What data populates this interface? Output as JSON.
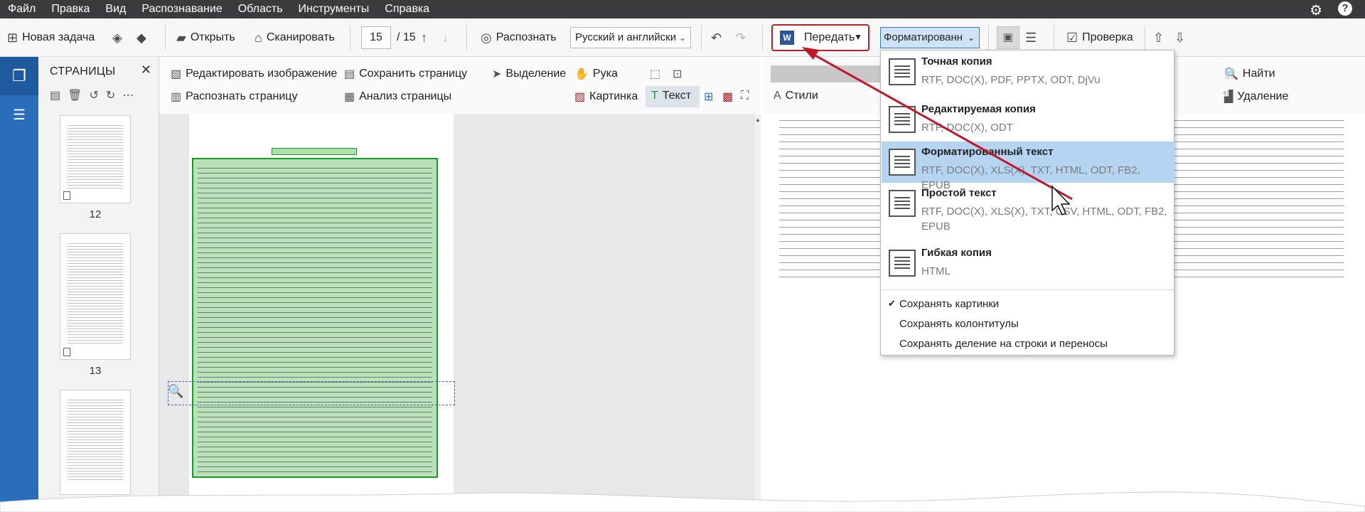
{
  "menubar": {
    "items": [
      "Файл",
      "Правка",
      "Вид",
      "Распознавание",
      "Область",
      "Инструменты",
      "Справка"
    ],
    "help_label": "?"
  },
  "toolbar": {
    "new_task": "Новая задача",
    "open": "Открыть",
    "scan": "Сканировать",
    "page_current": "15",
    "page_total": "/ 15",
    "recognize": "Распознать",
    "language": "Русский и английски",
    "transfer": "Передать",
    "transfer_icon_letter": "W",
    "format": "Форматированн",
    "check": "Проверка"
  },
  "pages_panel": {
    "title": "СТРАНИЦЫ",
    "page_numbers": [
      "12",
      "13"
    ]
  },
  "image_tools": {
    "edit_image": "Редактировать изображение",
    "save_page": "Сохранить страницу",
    "recognize_page": "Распознать страницу",
    "analyze_page": "Анализ страницы",
    "selection": "Выделение",
    "hand": "Рука",
    "text": "Текст",
    "picture": "Картинка"
  },
  "text_tools": {
    "styles": "Стили",
    "find": "Найти",
    "delete": "Удаление"
  },
  "format_menu": {
    "options": [
      {
        "title": "Точная копия",
        "desc": "RTF, DOC(X), PDF, PPTX, ODT, DjVu",
        "selected": false
      },
      {
        "title": "Редактируемая копия",
        "desc": "RTF, DOC(X), ODT",
        "selected": false
      },
      {
        "title": "Форматированный текст",
        "desc": "RTF, DOC(X), XLS(X), TXT, HTML, ODT, FB2, EPUB",
        "selected": true
      },
      {
        "title": "Простой текст",
        "desc": "RTF, DOC(X), XLS(X), TXT, CSV, HTML, ODT, FB2, EPUB",
        "selected": false
      },
      {
        "title": "Гибкая копия",
        "desc": "HTML",
        "selected": false
      }
    ],
    "checks": [
      {
        "label": "Сохранять картинки",
        "checked": true
      },
      {
        "label": "Сохранять колонтитулы",
        "checked": false
      },
      {
        "label": "Сохранять деление на строки и переносы",
        "checked": false
      }
    ]
  },
  "colors": {
    "accent": "#2a6ebb",
    "highlight_border": "#b0232a",
    "selection_green": "#1a9a27",
    "menu_selected": "#b5d4f1"
  }
}
